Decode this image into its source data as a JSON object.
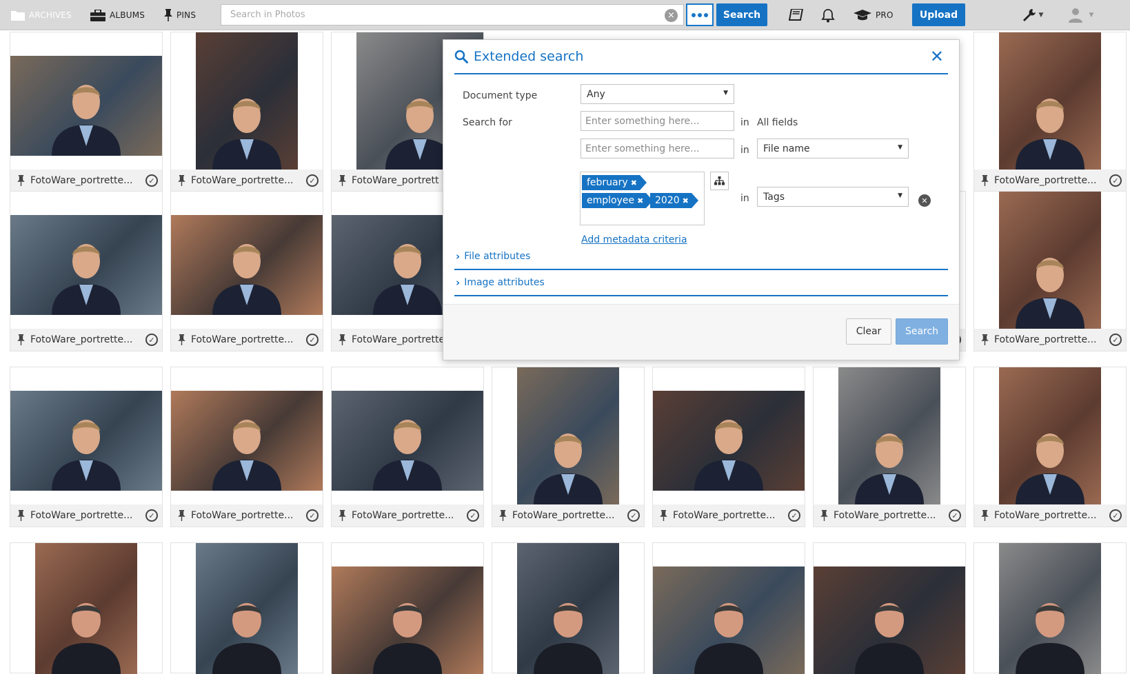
{
  "nav": {
    "archives": "ARCHIVES",
    "albums": "ALBUMS",
    "pins": "PINS",
    "pro": "PRO"
  },
  "search": {
    "placeholder": "Search in Photos",
    "button": "Search"
  },
  "toolbar": {
    "upload": "Upload"
  },
  "dialog": {
    "title": "Extended search",
    "document_type_label": "Document type",
    "document_type_value": "Any",
    "search_for_label": "Search for",
    "field1_placeholder": "Enter something here...",
    "field1_in": "in",
    "field1_scope": "All fields",
    "field2_placeholder": "Enter something here...",
    "field2_in": "in",
    "field2_scope": "File name",
    "tags_in": "in",
    "tags_scope": "Tags",
    "tags": [
      "february",
      "employee",
      "2020"
    ],
    "add_metadata": "Add metadata criteria",
    "file_attributes": "File attributes",
    "image_attributes": "Image attributes",
    "clear_button": "Clear",
    "search_button": "Search"
  },
  "photos": [
    {
      "caption": "FotoWare_portrette..."
    },
    {
      "caption": "FotoWare_portrette..."
    },
    {
      "caption": "FotoWare_portrett"
    },
    {
      "caption": "FotoWare_portrette..."
    },
    {
      "caption": "FotoWare_portrette..."
    },
    {
      "caption": "FotoWare_portrette..."
    },
    {
      "caption": "FotoWare_portrette..."
    },
    {
      "caption": "FotoWare_portrette..."
    },
    {
      "caption": "FotoWare_portrette..."
    },
    {
      "caption": "FotoWare_portrette..."
    },
    {
      "caption": "FotoWare_portrette..."
    },
    {
      "caption": "FotoWare_portrette..."
    },
    {
      "caption": "FotoWare_portrette..."
    },
    {
      "caption": "FotoWare_portrette..."
    },
    {
      "caption": "FotoWare_portrette..."
    },
    {
      "caption": "FotoWare_portrette..."
    },
    {
      "caption": "FotoWare_portrette..."
    },
    {
      "caption": "FotoWare_portrette..."
    },
    {
      "caption": "FotoWare_portrette..."
    },
    {
      "caption": "FotoWare_portrette..."
    }
  ],
  "colors": {
    "accent": "#1673c4",
    "topbar": "#d9d9d9",
    "tag": "#1673c4",
    "search_disabled": "#7fb0e1"
  },
  "icons": [
    "folder-icon",
    "briefcase-icon",
    "pin-icon",
    "book-icon",
    "bell-icon",
    "graduation-cap-icon",
    "wrench-icon",
    "user-icon",
    "search-icon",
    "close-icon",
    "sitemap-icon",
    "check-circle-icon"
  ]
}
